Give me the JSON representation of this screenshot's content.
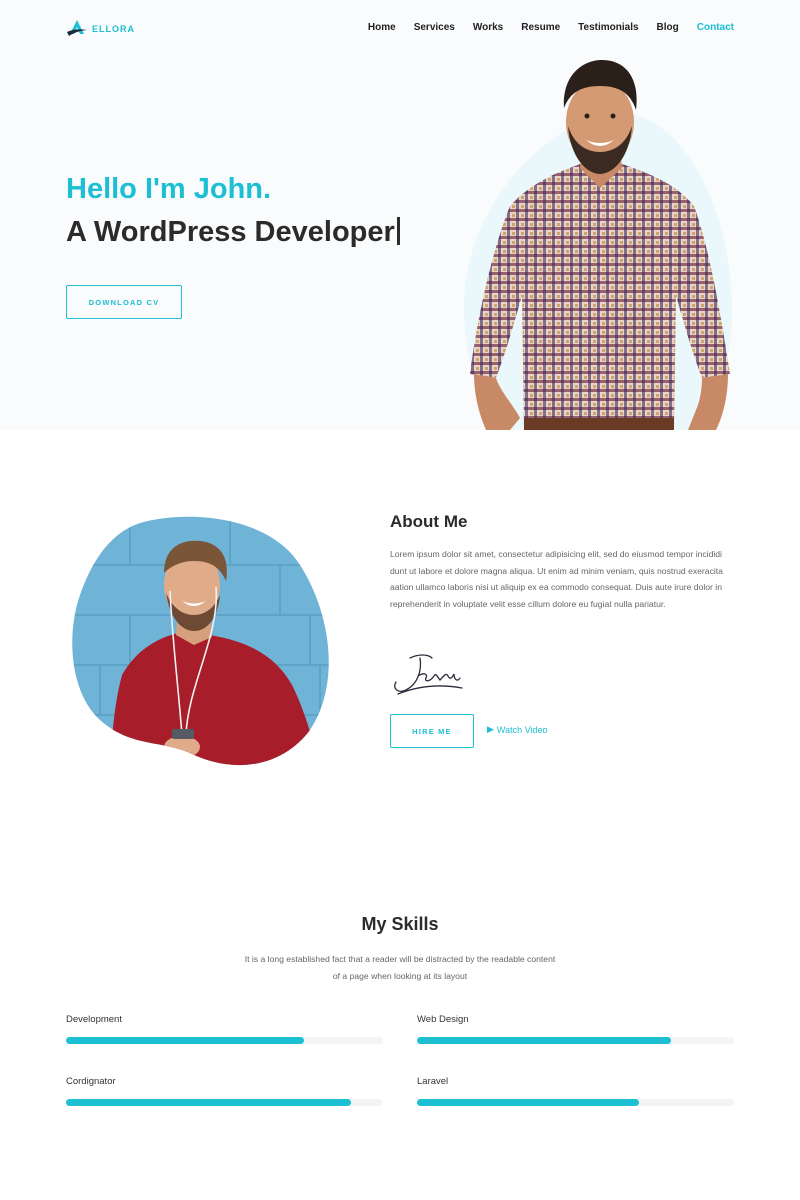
{
  "brand": {
    "name": "ELLORA",
    "logo_icon": "ellora-logo-icon",
    "accent": "#1dbfd3"
  },
  "nav": {
    "items": [
      {
        "label": "Home"
      },
      {
        "label": "Services"
      },
      {
        "label": "Works"
      },
      {
        "label": "Resume"
      },
      {
        "label": "Testimonials"
      },
      {
        "label": "Blog"
      },
      {
        "label": "Contact",
        "active": true
      }
    ]
  },
  "hero": {
    "greeting": "Hello I'm John.",
    "role": "A WordPress Developer",
    "cv_button": "DOWNLOAD CV"
  },
  "about": {
    "title": "About Me",
    "text": "Lorem ipsum dolor sit amet, consectetur adipisicing elit, sed do eiusmod tempor incididi dunt ut labore et dolore magna aliqua. Ut enim ad minim veniam, quis nostrud exeracita aation ullamco laboris nisi ut aliquip ex ea commodo consequat. Duis aute irure dolor in reprehenderit in voluptate velit esse cillum dolore eu fugiat nulla pariatur.",
    "hire_button": "HIRE ME",
    "watch_video": "Watch Video",
    "play_icon": "play-icon"
  },
  "skills": {
    "title": "My Skills",
    "subtitle": "It is a long established fact that a reader will be distracted by the readable content of a page when looking at its layout",
    "items": [
      {
        "label": "Development",
        "level": 0.75
      },
      {
        "label": "Web Design",
        "level": 0.8
      },
      {
        "label": "Cordignator",
        "level": 0.9
      },
      {
        "label": "Laravel",
        "level": 0.7
      }
    ]
  }
}
